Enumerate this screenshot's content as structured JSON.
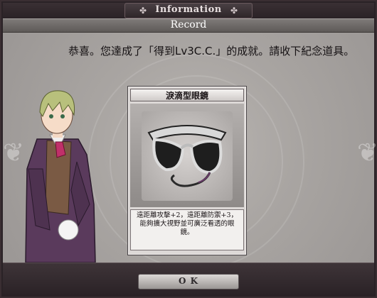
{
  "window": {
    "title": "Information",
    "header": "Record"
  },
  "message": "恭喜。您達成了「得到Lv3C.C.」的成就。請收下紀念道具。",
  "reward_card": {
    "item_name": "淚滴型眼鏡",
    "description": "遠距離攻擊+2，遠距離防禦+3，能夠擴大視野並可廣泛看透的眼鏡。"
  },
  "buttons": {
    "ok_label": "O K"
  },
  "icons": {
    "title_ornament_left": "ornament-icon",
    "title_ornament_right": "ornament-icon",
    "item_image": "teardrop-glasses-icon",
    "character": "character-portrait"
  },
  "colors": {
    "frame": "#2a2226",
    "header_bar": "#6e6a68",
    "content_bg": "#a9a5a2",
    "text": "#161214"
  }
}
